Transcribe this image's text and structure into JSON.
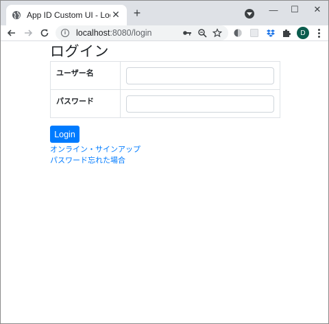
{
  "browser": {
    "tab": {
      "title": "App ID Custom UI - Login",
      "close_label": "✕"
    },
    "new_tab_label": "+",
    "window_controls": {
      "minimize": "—",
      "maximize": "☐",
      "close": "✕"
    },
    "address": {
      "host": "localhost",
      "path": ":8080/login"
    },
    "profile_initial": "D"
  },
  "page": {
    "title": "ログイン",
    "form": {
      "username_label": "ユーザー名",
      "password_label": "パスワード",
      "username_value": "",
      "password_value": ""
    },
    "login_button": "Login",
    "links": {
      "signup": "オンライン・サインアップ",
      "forgot_password": "パスワード忘れた場合"
    }
  },
  "colors": {
    "primary": "#007bff",
    "tab_strip": "#dee1e6",
    "profile_avatar": "#0b5d4e"
  }
}
